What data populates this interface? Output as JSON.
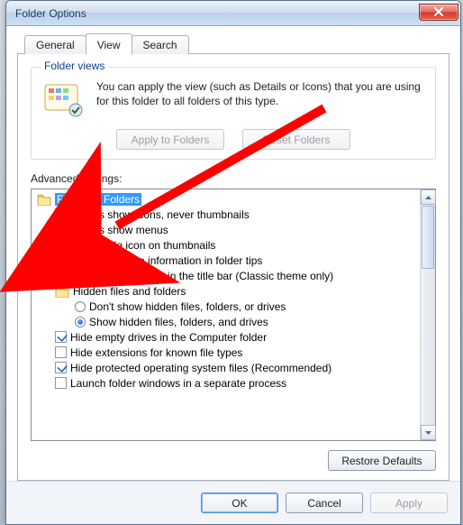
{
  "window": {
    "title": "Folder Options"
  },
  "tabs": {
    "general": "General",
    "view": "View",
    "search": "Search",
    "active": "view"
  },
  "folderViews": {
    "legend": "Folder views",
    "text": "You can apply the view (such as Details or Icons) that you are using for this folder to all folders of this type.",
    "applyBtn": "Apply to Folders",
    "resetBtn": "Reset Folders"
  },
  "advanced": {
    "label": "Advanced settings:",
    "rootLabel": "Files and Folders",
    "items": [
      {
        "type": "check",
        "checked": false,
        "label": "Always show icons, never thumbnails"
      },
      {
        "type": "check",
        "checked": true,
        "label": "Always show menus"
      },
      {
        "type": "check",
        "checked": false,
        "label": "Display file icon on thumbnails"
      },
      {
        "type": "check",
        "checked": true,
        "label": "Display file size information in folder tips"
      },
      {
        "type": "check",
        "checked": false,
        "label": "Display the full path in the title bar (Classic theme only)"
      },
      {
        "type": "folder",
        "label": "Hidden files and folders"
      },
      {
        "type": "radio",
        "checked": false,
        "label": "Don't show hidden files, folders, or drives"
      },
      {
        "type": "radio",
        "checked": true,
        "label": "Show hidden files, folders, and drives"
      },
      {
        "type": "check",
        "checked": true,
        "label": "Hide empty drives in the Computer folder"
      },
      {
        "type": "check",
        "checked": false,
        "label": "Hide extensions for known file types"
      },
      {
        "type": "check",
        "checked": true,
        "label": "Hide protected operating system files (Recommended)"
      },
      {
        "type": "check",
        "checked": false,
        "label": "Launch folder windows in a separate process"
      }
    ],
    "restoreBtn": "Restore Defaults"
  },
  "buttons": {
    "ok": "OK",
    "cancel": "Cancel",
    "apply": "Apply"
  }
}
